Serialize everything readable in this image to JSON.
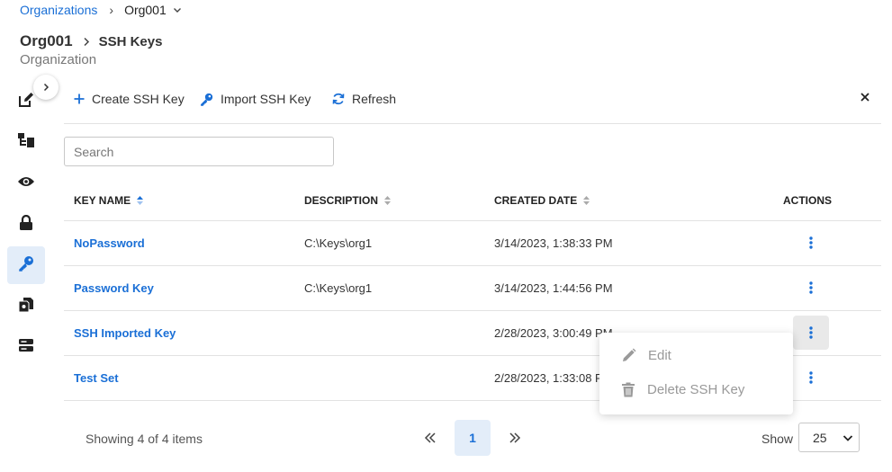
{
  "breadcrumb": {
    "root": "Organizations",
    "separator": "›",
    "current": "Org001"
  },
  "header": {
    "title": "Org001",
    "section": "SSH Keys",
    "subtitle": "Organization"
  },
  "sidebar": {
    "items": [
      {
        "icon": "edit-icon"
      },
      {
        "icon": "hierarchy-icon"
      },
      {
        "icon": "eye-icon"
      },
      {
        "icon": "lock-icon"
      },
      {
        "icon": "key-icon",
        "active": true
      },
      {
        "icon": "documents-icon"
      },
      {
        "icon": "server-icon"
      }
    ]
  },
  "toolbar": {
    "create_label": "Create SSH Key",
    "import_label": "Import SSH Key",
    "refresh_label": "Refresh"
  },
  "search": {
    "placeholder": "Search",
    "value": ""
  },
  "table": {
    "columns": {
      "name": "KEY NAME",
      "description": "DESCRIPTION",
      "created": "CREATED DATE",
      "actions": "ACTIONS"
    },
    "rows": [
      {
        "name": "NoPassword",
        "description": "C:\\Keys\\org1",
        "created": "3/14/2023, 1:38:33 PM"
      },
      {
        "name": "Password Key",
        "description": "C:\\Keys\\org1",
        "created": "3/14/2023, 1:44:56 PM"
      },
      {
        "name": "SSH Imported Key",
        "description": "",
        "created": "2/28/2023, 3:00:49 PM"
      },
      {
        "name": "Test Set",
        "description": "",
        "created": "2/28/2023, 1:33:08 PM"
      }
    ]
  },
  "context_menu": {
    "edit_label": "Edit",
    "delete_label": "Delete SSH Key"
  },
  "footer": {
    "info": "Showing 4 of 4 items",
    "current_page": "1",
    "show_label": "Show",
    "page_size": "25"
  },
  "colors": {
    "accent": "#1a6fd6",
    "active_bg": "#e3edf9"
  }
}
